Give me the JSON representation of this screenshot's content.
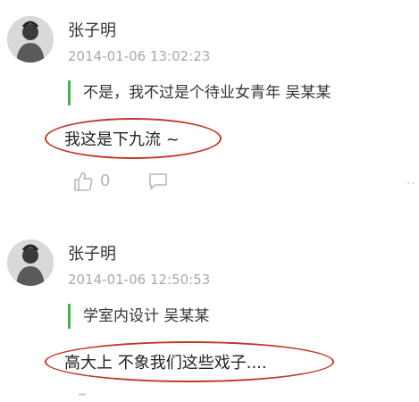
{
  "comments": [
    {
      "name": "张子明",
      "time": "2014-01-06 13:02:23",
      "quote": "不是，我不过是个待业女青年 吴某某",
      "reply": "我这是下九流 ~",
      "likes": "0",
      "icons": [
        "avatar",
        "like-icon",
        "comment-icon"
      ]
    },
    {
      "name": "张子明",
      "time": "2014-01-06 12:50:53",
      "quote": "学室内设计 吴某某",
      "reply": "高大上 不象我们这些戏子....",
      "icons": [
        "avatar"
      ]
    }
  ],
  "colors": {
    "quote_bar": "#3fb54a",
    "highlight_oval": "#c0392b",
    "meta_text": "#a9a9a9"
  }
}
